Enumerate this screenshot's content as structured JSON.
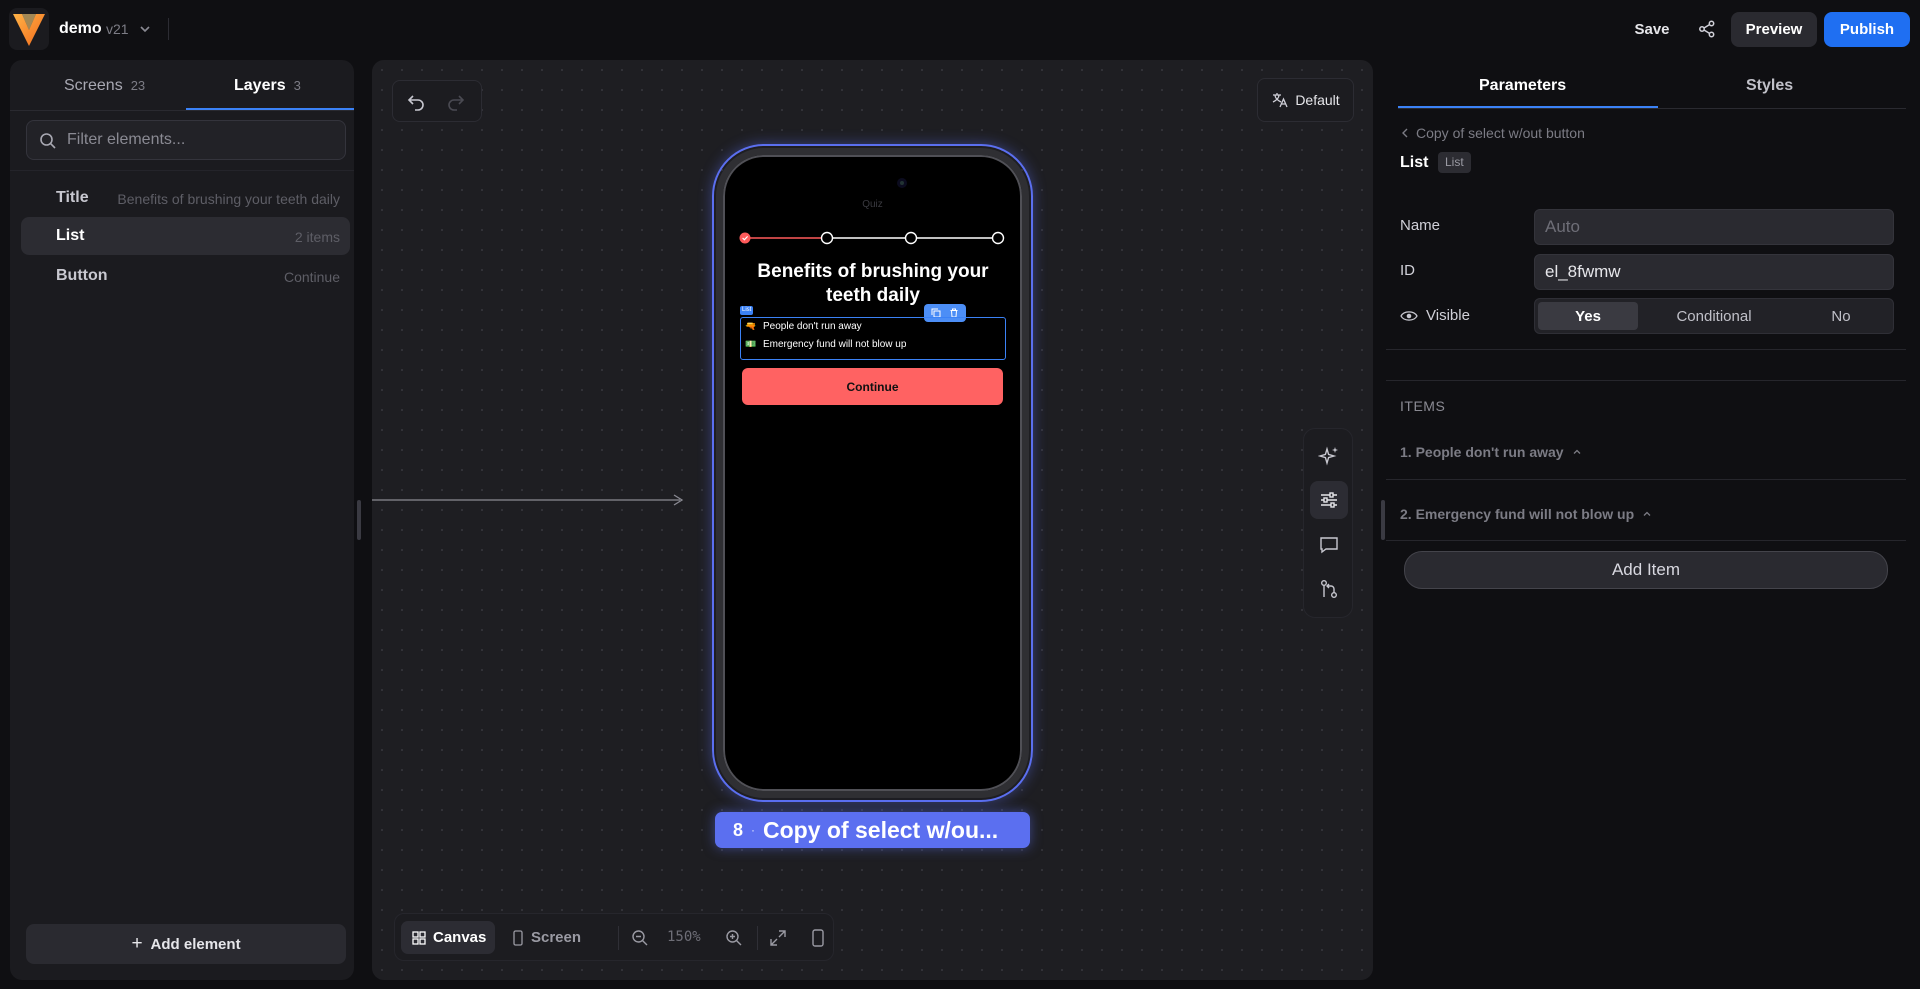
{
  "topbar": {
    "project_name": "demo",
    "version": "v21",
    "save_label": "Save",
    "preview_label": "Preview",
    "publish_label": "Publish",
    "brand_color": "#f7941d",
    "publish_color": "#1f6ff2"
  },
  "left_panel": {
    "tabs": [
      {
        "label": "Screens",
        "count": "23"
      },
      {
        "label": "Layers",
        "count": "3"
      }
    ],
    "filter_placeholder": "Filter elements...",
    "layers": [
      {
        "name": "Title",
        "meta": "Benefits of brushing your teeth daily"
      },
      {
        "name": "List",
        "meta": "2 items"
      },
      {
        "name": "Button",
        "meta": "Continue"
      }
    ],
    "add_element_label": "Add element"
  },
  "canvas": {
    "language_label": "Default",
    "phone": {
      "header": "Quiz",
      "title": "Benefits of brushing your teeth daily",
      "list_tag": "List",
      "list_items": [
        {
          "emoji": "🔫",
          "text": "People don't run away"
        },
        {
          "emoji": "💵",
          "text": "Emergency fund will not blow up"
        }
      ],
      "button_label": "Continue",
      "button_color": "#ff6262"
    },
    "screen_label": {
      "number": "8",
      "name": "Copy of select w/ou..."
    },
    "bottom_bar": {
      "canvas_label": "Canvas",
      "screen_label": "Screen",
      "zoom": "150%"
    }
  },
  "right_panel": {
    "tabs": [
      "Parameters",
      "Styles"
    ],
    "back_label": "Copy of select w/out button",
    "element_title": "List",
    "element_badge": "List",
    "name_label": "Name",
    "name_placeholder": "Auto",
    "id_label": "ID",
    "id_value": "el_8fwmw",
    "visible_label": "Visible",
    "visible_options": [
      "Yes",
      "Conditional",
      "No"
    ],
    "items_header": "ITEMS",
    "items": [
      "1. People don't run away",
      "2. Emergency fund will not blow up"
    ],
    "add_item_label": "Add Item"
  }
}
